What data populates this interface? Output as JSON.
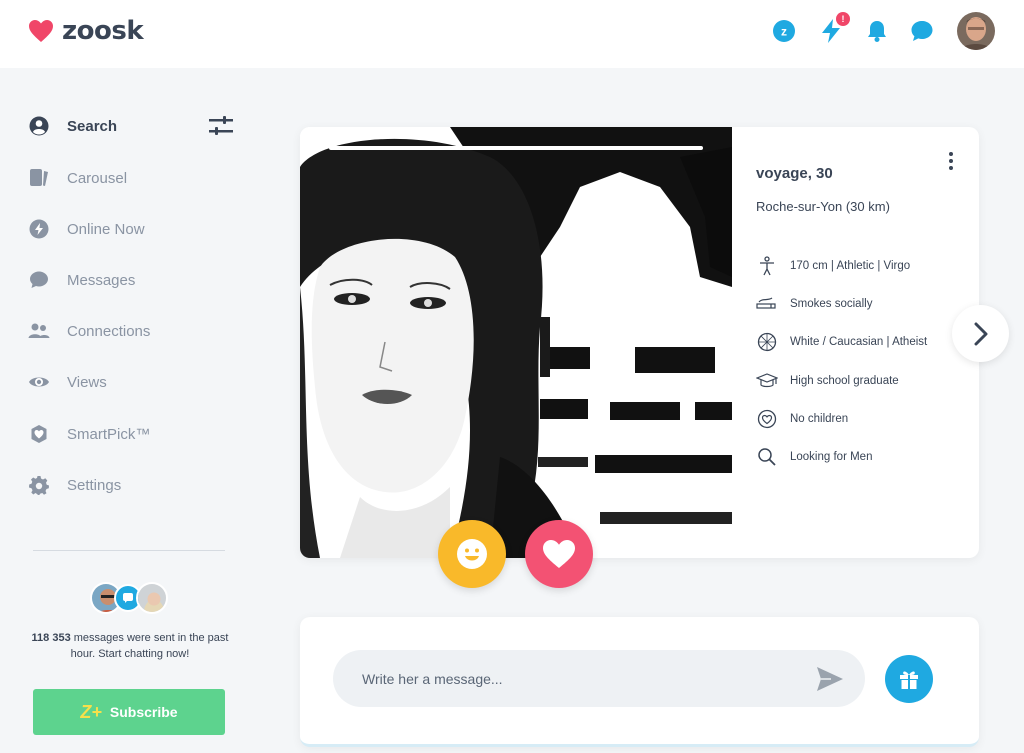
{
  "brand": {
    "name": "zoosk",
    "heart_color": "#f04668"
  },
  "header": {
    "icons": [
      "coins-icon",
      "boost-icon",
      "bell-icon",
      "chat-icon"
    ],
    "notification_count": "!",
    "accent": "#1fa9e1"
  },
  "sidebar": {
    "items": [
      {
        "label": "Search",
        "icon": "user-circle-icon",
        "active": true
      },
      {
        "label": "Carousel",
        "icon": "carousel-icon"
      },
      {
        "label": "Online Now",
        "icon": "bolt-icon"
      },
      {
        "label": "Messages",
        "icon": "speech-bubble-icon"
      },
      {
        "label": "Connections",
        "icon": "users-icon"
      },
      {
        "label": "Views",
        "icon": "eye-icon"
      },
      {
        "label": "SmartPick™",
        "icon": "smartpick-icon"
      },
      {
        "label": "Settings",
        "icon": "gear-icon"
      }
    ],
    "activity_count": "118 353",
    "activity_text": " messages were sent in the past hour. Start chatting now!",
    "subscribe_label": "Subscribe",
    "subscribe_badge": "Z+",
    "subscribe_color": "#5dd38e"
  },
  "profile": {
    "name_age": "voyage, 30",
    "location": "Roche-sur-Yon (30 km)",
    "details": [
      {
        "icon": "body-icon",
        "text": "170 cm | Athletic | Virgo"
      },
      {
        "icon": "cigarette-icon",
        "text": "Smokes socially"
      },
      {
        "icon": "globe-icon",
        "text": "White / Caucasian | Atheist"
      },
      {
        "icon": "graduation-cap-icon",
        "text": "High school graduate"
      },
      {
        "icon": "heart-outline-icon",
        "text": "No children"
      },
      {
        "icon": "search-icon",
        "text": "Looking for Men"
      }
    ]
  },
  "actions": {
    "smile_color": "#f9b92a",
    "like_color": "#f35273"
  },
  "message": {
    "placeholder": "Write her a message..."
  }
}
